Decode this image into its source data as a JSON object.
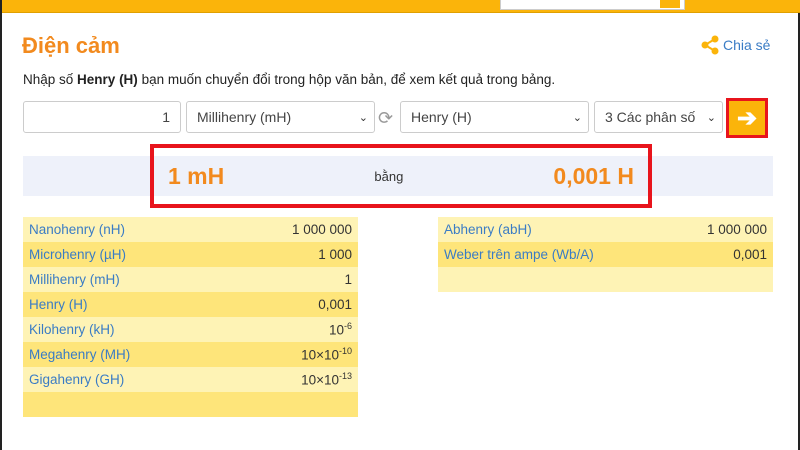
{
  "title": "Điện cảm",
  "share_label": "Chia sẻ",
  "intro": {
    "pre": "Nhập số ",
    "bold": "Henry (H)",
    "post": " bạn muốn chuyển đổi trong hộp văn bản, để xem kết quả trong bảng."
  },
  "converter": {
    "value": "1",
    "from_unit": "Millihenry (mH)",
    "to_unit": "Henry (H)",
    "precision": "3 Các phân số"
  },
  "result": {
    "from": "1 mH",
    "equals": "bằng",
    "to": "0,001 H"
  },
  "table_left": [
    {
      "unit": "Nanohenry (nH)",
      "value": "1 000 000"
    },
    {
      "unit": "Microhenry (µH)",
      "value": "1 000"
    },
    {
      "unit": "Millihenry (mH)",
      "value": "1"
    },
    {
      "unit": "Henry (H)",
      "value": "0,001"
    },
    {
      "unit": "Kilohenry (kH)",
      "value": "10",
      "exp": "-6"
    },
    {
      "unit": "Megahenry (MH)",
      "value": "10×10",
      "exp": "-10"
    },
    {
      "unit": "Gigahenry (GH)",
      "value": "10×10",
      "exp": "-13"
    },
    {
      "unit": "",
      "value": ""
    }
  ],
  "table_right": [
    {
      "unit": "Abhenry (abH)",
      "value": "1 000 000"
    },
    {
      "unit": "Weber trên ampe (Wb/A)",
      "value": "0,001"
    },
    {
      "unit": "",
      "value": ""
    }
  ]
}
